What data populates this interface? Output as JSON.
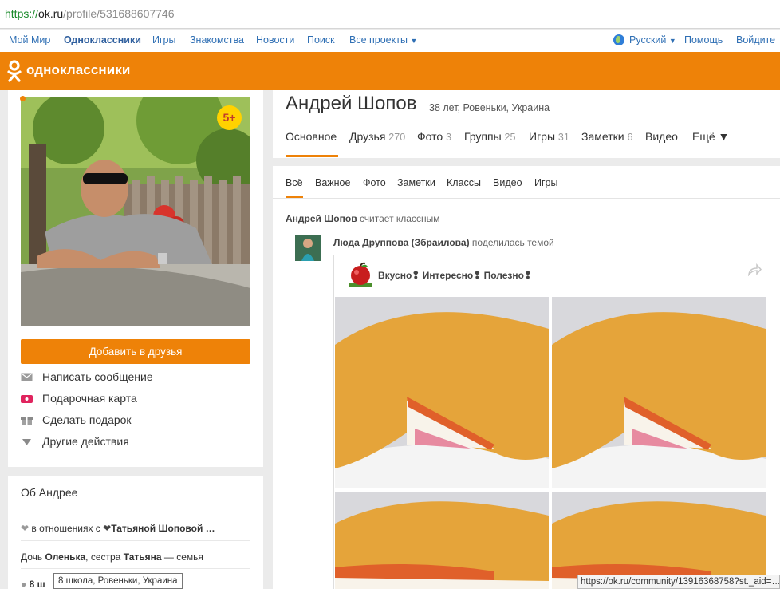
{
  "browser": {
    "url_scheme": "https://",
    "url_host": "ok.ru",
    "url_path": "/profile/531688607746"
  },
  "portal_nav": {
    "items": [
      "Мой Мир",
      "Одноклассники",
      "Игры",
      "Знакомства",
      "Новости",
      "Поиск",
      "Все проекты"
    ],
    "language": "Русский",
    "help": "Помощь",
    "login": "Войдите"
  },
  "header": {
    "logo_text": "одноклассники"
  },
  "profile": {
    "name": "Андрей Шопов",
    "meta": "38 лет, Ровеньки, Украина",
    "age_badge": "5+",
    "add_friend": "Добавить в друзья",
    "actions": [
      "Написать сообщение",
      "Подарочная карта",
      "Сделать подарок",
      "Другие действия"
    ]
  },
  "profile_tabs": [
    {
      "label": "Основное",
      "count": ""
    },
    {
      "label": "Друзья",
      "count": "270"
    },
    {
      "label": "Фото",
      "count": "3"
    },
    {
      "label": "Группы",
      "count": "25"
    },
    {
      "label": "Игры",
      "count": "31"
    },
    {
      "label": "Заметки",
      "count": "6"
    },
    {
      "label": "Видео",
      "count": ""
    },
    {
      "label": "Ещё ▼",
      "count": ""
    }
  ],
  "about": {
    "title": "Об Андрее",
    "relationship_prefix": "в отношениях с",
    "relationship_name": "Татьяной Шоповой …",
    "family_prefix": "Дочь",
    "daughter": "Оленька",
    "family_mid": ", сестра",
    "sister": "Татьяна",
    "family_suffix": " — семья",
    "school_partial": "8 ш",
    "tooltip": "8 школа, Ровеньки, Украина"
  },
  "feed": {
    "tabs": [
      "Всё",
      "Важное",
      "Фото",
      "Заметки",
      "Классы",
      "Видео",
      "Игры"
    ],
    "liker_name": "Андрей Шопов",
    "liker_suffix": "считает классным",
    "sharer_name": "Люда Друппова (Збраилова)",
    "sharer_suffix": "поделилась темой",
    "post_title": "Вкусно❢ Интересно❢ Полезно❢"
  },
  "status_url": "https://ok.ru/community/13916368758?st._aid=…",
  "colors": {
    "brand_orange": "#ee8208",
    "link_blue": "#2f6fb4"
  }
}
